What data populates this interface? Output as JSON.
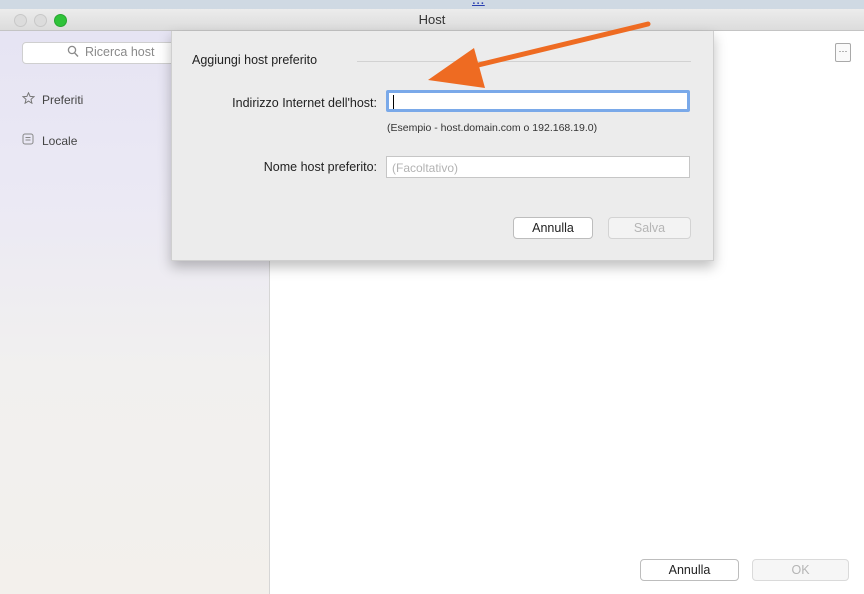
{
  "top_strip": {
    "link_fragment": "..."
  },
  "window": {
    "title": "Host"
  },
  "sidebar": {
    "search": {
      "placeholder": "Ricerca host"
    },
    "items": [
      {
        "label": "Preferiti",
        "icon": "star-icon"
      },
      {
        "label": "Locale",
        "icon": "local-icon"
      }
    ]
  },
  "sheet": {
    "title": "Aggiungi host preferito",
    "address_label": "Indirizzo Internet dell'host:",
    "address_value": "",
    "address_hint": "(Esempio - host.domain.com o 192.168.19.0)",
    "name_label": "Nome host preferito:",
    "name_placeholder": "(Facoltativo)",
    "cancel_label": "Annulla",
    "save_label": "Salva"
  },
  "footer": {
    "cancel_label": "Annulla",
    "ok_label": "OK"
  },
  "colors": {
    "arrow": "#ee6b22",
    "focus_ring": "#7aa9e9",
    "zoom_button": "#2fc33a"
  }
}
